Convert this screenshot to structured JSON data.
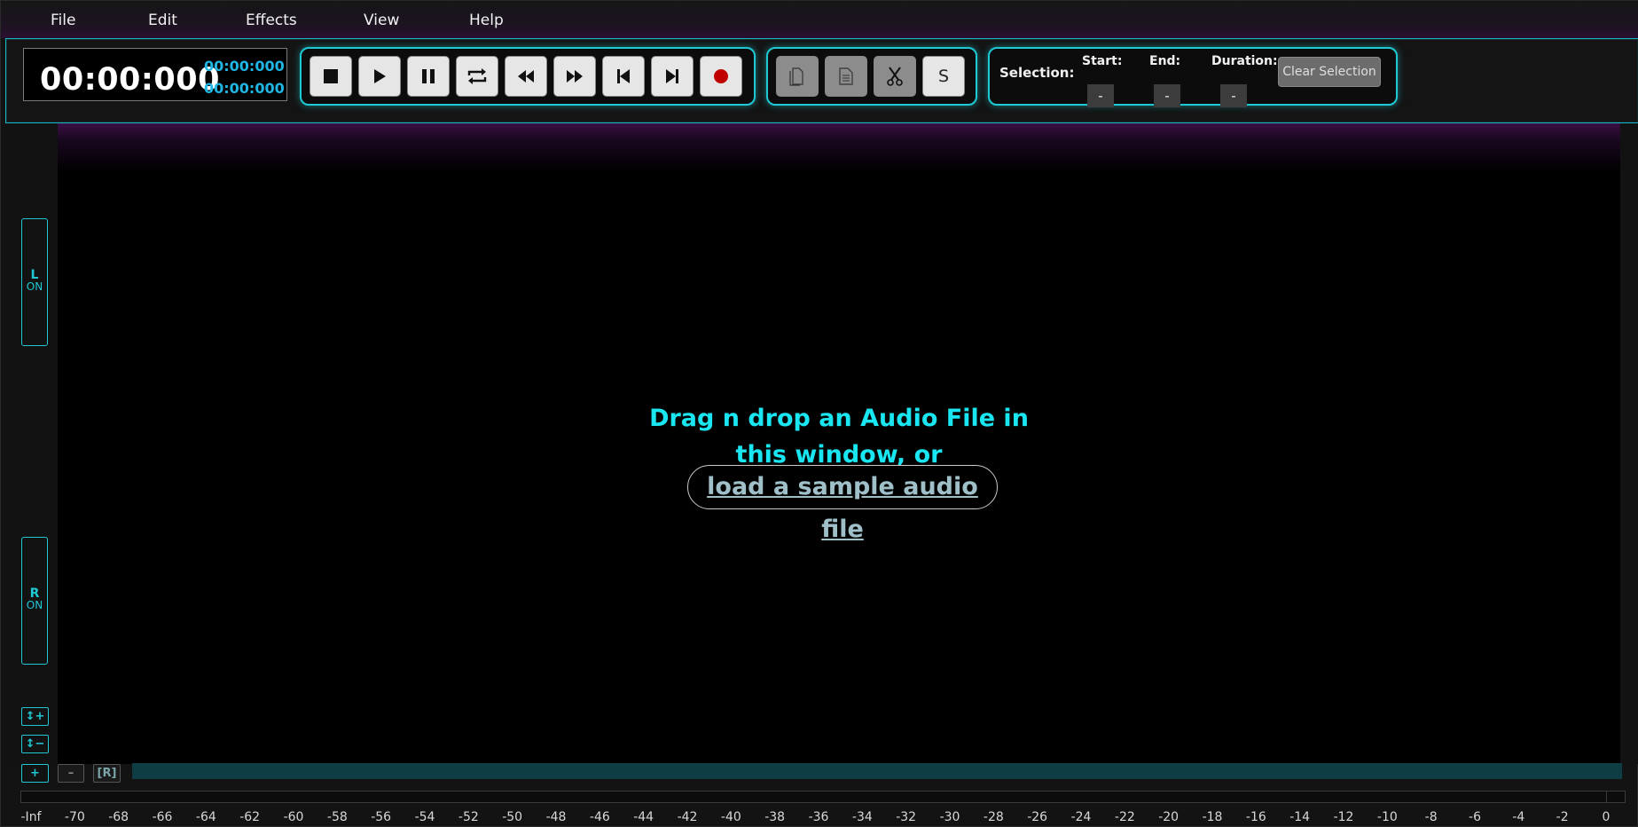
{
  "menu": [
    "File",
    "Edit",
    "Effects",
    "View",
    "Help"
  ],
  "time": {
    "main": "00:00:000",
    "sub1": "00:00:000",
    "sub2": "00:00:000"
  },
  "transport": [
    {
      "name": "stop",
      "icon": "stop-icon"
    },
    {
      "name": "play",
      "icon": "play-icon"
    },
    {
      "name": "pause",
      "icon": "pause-icon"
    },
    {
      "name": "loop",
      "icon": "loop-icon"
    },
    {
      "name": "rewind",
      "icon": "rewind-icon"
    },
    {
      "name": "fast-forward",
      "icon": "fast-forward-icon"
    },
    {
      "name": "skip-to-start",
      "icon": "skip-to-start-icon"
    },
    {
      "name": "skip-to-end",
      "icon": "skip-to-end-icon"
    },
    {
      "name": "record",
      "icon": "record-icon"
    }
  ],
  "edit_tools": {
    "copy_icon": "copy-icon",
    "paste_icon": "paste-icon",
    "cut_icon": "scissors-icon",
    "silence_label": "S"
  },
  "selection": {
    "label": "Selection:",
    "start_label": "Start:",
    "start_value": "-",
    "end_label": "End:",
    "end_value": "-",
    "duration_label": "Duration:",
    "duration_value": "-",
    "clear_label": "Clear Selection"
  },
  "channels": {
    "left": {
      "label": "L",
      "state": "ON"
    },
    "right": {
      "label": "R",
      "state": "ON"
    }
  },
  "zoom": {
    "v_zoom_in": "↕+",
    "v_zoom_out": "↕−",
    "h_zoom_in": "+",
    "h_zoom_out": "–",
    "reset": "[R]"
  },
  "dropzone": {
    "line1": "Drag n drop an Audio File in",
    "line2": "this window, or",
    "sample_link": "load a sample audio file"
  },
  "meter_ticks": [
    "-Inf",
    "-70",
    "-68",
    "-66",
    "-64",
    "-62",
    "-60",
    "-58",
    "-56",
    "-54",
    "-52",
    "-50",
    "-48",
    "-46",
    "-44",
    "-42",
    "-40",
    "-38",
    "-36",
    "-34",
    "-32",
    "-30",
    "-28",
    "-26",
    "-24",
    "-22",
    "-20",
    "-18",
    "-16",
    "-14",
    "-12",
    "-10",
    "-8",
    "-6",
    "-4",
    "-2",
    "0"
  ],
  "colors": {
    "accent": "#20c8d4",
    "drop_text": "#19e6f0",
    "record": "#c00000",
    "purple_glow": "#3a0f44"
  }
}
